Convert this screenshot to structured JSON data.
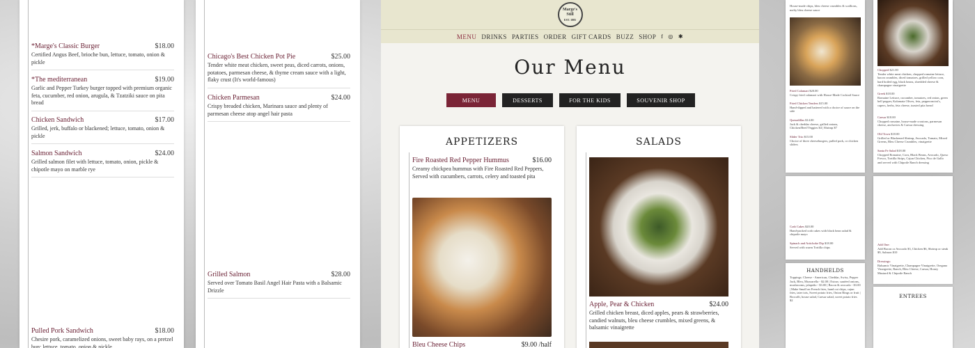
{
  "panel1": {
    "items": [
      {
        "name": "*Marge's Classic Burger",
        "price": "$18.00",
        "desc": "Certified Angus Beef, brioche bun, lettuce, tomato, onion & pickle"
      },
      {
        "name": "*The mediterranean",
        "price": "$19.00",
        "desc": "Garlic and Pepper Turkey burger topped with premium organic feta, cucumber, red onion, arugula, & Tzatziki sauce on pita bread"
      },
      {
        "name": "Chicken Sandwich",
        "price": "$17.00",
        "desc": "Grilled, jerk, buffalo or blackened; lettuce, tomato, onion & pickle"
      },
      {
        "name": "Salmon Sandwich",
        "price": "$24.00",
        "desc": "Grilled salmon filet with lettuce, tomato, onion, pickle & chipotle mayo on marble rye"
      },
      {
        "name": "Pulled Pork Sandwich",
        "price": "$18.00",
        "desc": "Chesire pork, caramelized onions, sweet baby rays, on a pretzel bun; lettuce, tomato, onion & pickle"
      }
    ]
  },
  "panel2": {
    "items": [
      {
        "name": "Chicago's Best Chicken Pot Pie",
        "price": "$25.00",
        "desc": "Tender white meat chicken, sweet peas, diced carrots, onions, potatoes, parmesan cheese, & thyme cream sauce with a light, flaky crust (It's world-famous)"
      },
      {
        "name": "Chicken Parmesan",
        "price": "$24.00",
        "desc": "Crispy breaded chicken, Marinara sauce and plenty of parmesan cheese atop angel hair pasta"
      },
      {
        "name": "Grilled Salmon",
        "price": "$28.00",
        "desc": "Served over Tomato Basil Angel Hair Pasta with a Balsamic Drizzle"
      }
    ]
  },
  "site": {
    "logo_line1": "Marge's",
    "logo_line2": "Still",
    "logo_line3": "EST. 1885",
    "nav": [
      "MENU",
      "DRINKS",
      "PARTIES",
      "ORDER",
      "GIFT CARDS",
      "BUZZ",
      "SHOP"
    ],
    "social": [
      "f",
      "◎",
      "✱"
    ],
    "title": "Our Menu",
    "buttons": [
      "MENU",
      "DESSERTS",
      "FOR THE KIDS",
      "SOUVENIR SHOP"
    ],
    "appetizers": {
      "heading": "APPETIZERS",
      "item1": {
        "name": "Fire Roasted Red Pepper Hummus",
        "price": "$16.00",
        "desc": "Creamy chickpea hummus with Fire Roasted Red Peppers, Served with cucumbers, carrots, celery and toasted pita"
      },
      "item2": {
        "name": "Bleu Cheese Chips",
        "price": "$9.00 /half"
      }
    },
    "salads": {
      "heading": "SALADS",
      "item1": {
        "name": "Apple, Pear & Chicken",
        "price": "$24.00",
        "desc": "Grilled chicken breast, diced apples, pears & strawberries, candied walnuts, bleu cheese crumbles, mixed greens, & balsamic vinaigrette"
      }
    }
  },
  "thumbs": {
    "t1_top": "House-made chips, bleu cheese crumbles & scallions, melty bleu cheese sauce",
    "t1_items": [
      {
        "name": "Fried Calamari",
        "price": "$20.00",
        "desc": "Crispy fried calamari with House-Made Cocktail Sauce"
      },
      {
        "name": "Fried Chicken Tenders",
        "price": "$15.00",
        "desc": "Hand-dipped and battered with a choice of sauce on the side"
      },
      {
        "name": "Quesadillas",
        "price": "$14.00",
        "desc": "Jack & cheddar cheese, grilled onions, Chicken/Beef/Veggies $4 | Shrimp $7"
      },
      {
        "name": "Slider Trio",
        "price": "$15.00",
        "desc": "Choice of three cheeseburgers, pulled pork, or chicken sliders"
      }
    ],
    "t2_items": [
      {
        "name": "Chopped",
        "price": "$21.00",
        "desc": "Tender white meat chicken, chopped romaine lettuce, bacon crumbles, diced tomatoes, grilled yellow corn, hard boiled egg, black beans, shredded cheese & champagne vinaigrette"
      },
      {
        "name": "Greek",
        "price": "$18.00",
        "desc": "Romaine Lettuce, cucumber, tomatoes, red onion, green bell pepper, Kalamata Olives, feta, pepperoncini's, capers, herbs, feta cheese, toasted pita bread"
      },
      {
        "name": "Caesar",
        "price": "$18.00",
        "desc": "Chopped romaine, house-made croutons, parmesan cheese, anchovies & Caesar dressing"
      },
      {
        "name": "Old Town",
        "price": "$18.00",
        "desc": "Grilled or Blackened Shrimp, Avocado, Tomato, Mixed Greens, Bleu Cheese Crumbles, vinaigrette"
      },
      {
        "name": "Santa Fe Salad",
        "price": "$18.00",
        "desc": "Chopped Romaine, Corn, Black Beans, Avocado, Queso Fresco, Tortilla Strips, Cajun Chicken, Pico de Gallo and served with Chipotle Ranch dressing"
      }
    ],
    "t3_items": [
      {
        "name": "Crab Cakes",
        "price": "$20.00",
        "desc": "Hand-packed crab cakes with black bean salad & chipotle mayo"
      },
      {
        "name": "Spinach and Artichoke Dip",
        "price": "$18.00",
        "desc": "Served with warm Tortilla chips"
      }
    ],
    "t4_addone": "Add One:",
    "t4_addone_desc": "Add Bacon or Avocado $3, Chicken $6, Shrimp or steak $9, Salmon $10",
    "t4_dressings": "Dressings:",
    "t4_dressings_desc": "Balsamic Vinaigrette, Champagne Vinaigrette, Oregano Vinaigrette, Ranch, Bleu Cheese, Caesar, Honey Mustard & Chipotle Ranch",
    "t5_heading": "HANDHELDS",
    "t5_desc": "Toppings: Cheese - American, Cheddar, Swiss, Pepper Jack, Bleu, Mozzarella - $2.00 | Extras: sautéed onions, mushrooms, jalapeño - $3.00 | Bacon & avocado - $3.00 | Make Small on French fries, hand cut chips, cajun fries, tater tots, Sweet potato fries, Onion Rings or fruit | Brocolli, house salad, Caesar salad, sweet potato fries $2",
    "t6_heading": "ENTREES"
  }
}
